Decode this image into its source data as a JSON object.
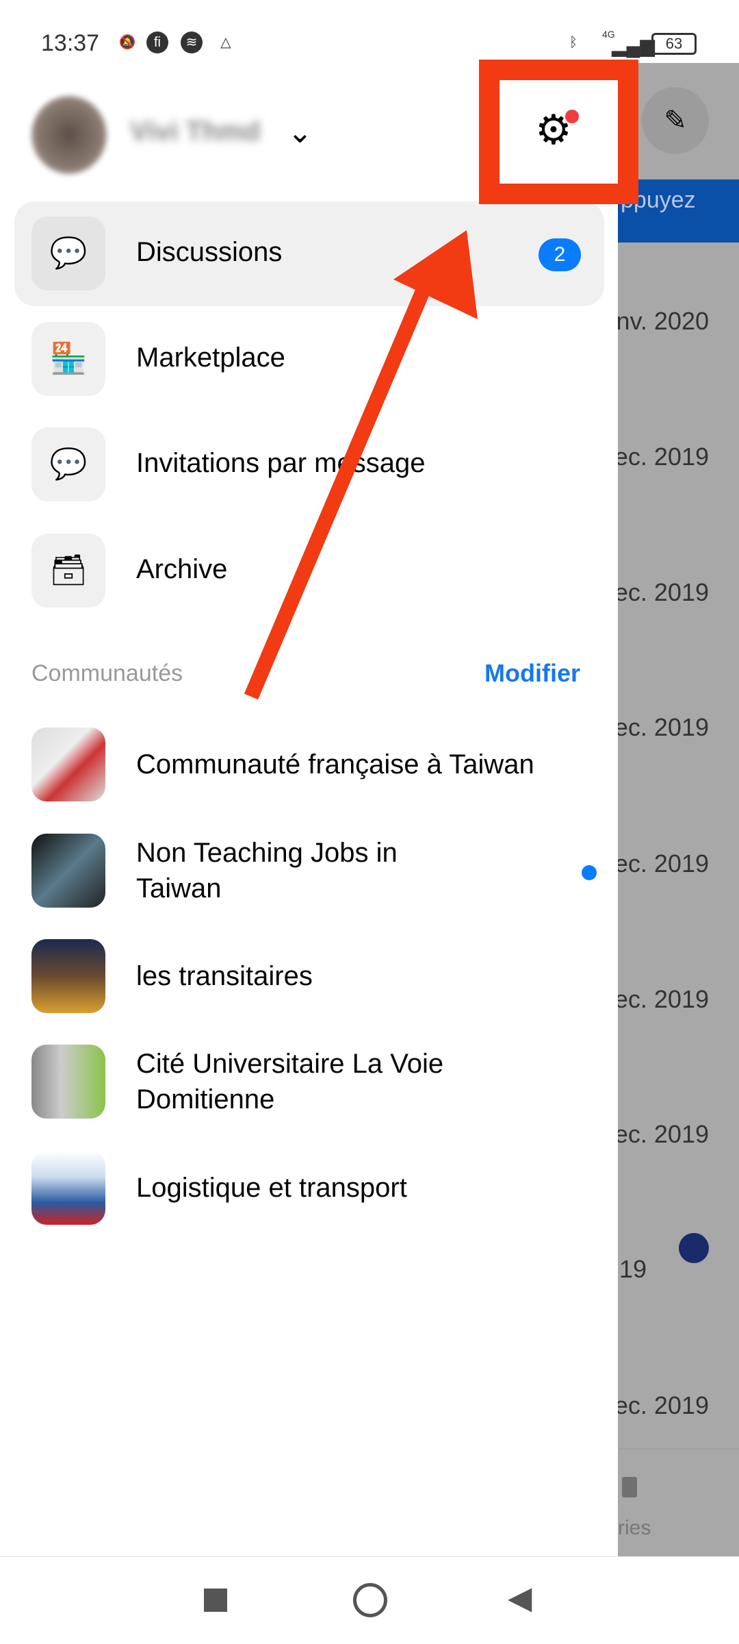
{
  "status_bar": {
    "time": "13:37",
    "battery": "63",
    "network": "4G"
  },
  "header": {
    "user_name": "Vivi Thmd"
  },
  "menu": [
    {
      "label": "Discussions",
      "icon": "chat-bubble-icon",
      "badge": "2",
      "selected": true
    },
    {
      "label": "Marketplace",
      "icon": "shop-icon"
    },
    {
      "label": "Invitations par message",
      "icon": "message-dots-icon"
    },
    {
      "label": "Archive",
      "icon": "archive-box-icon"
    }
  ],
  "communities": {
    "title": "Communautés",
    "edit_label": "Modifier",
    "items": [
      {
        "label": "Communauté française à Taiwan",
        "unread": false
      },
      {
        "label": "Non Teaching Jobs in Taiwan",
        "unread": true
      },
      {
        "label": "les transitaires",
        "unread": false
      },
      {
        "label": "Cité Universitaire La Voie Domitienne",
        "unread": false
      },
      {
        "label": "Logistique et transport",
        "unread": false
      }
    ]
  },
  "background": {
    "banner": "ppuyez",
    "dates": [
      "nv. 2020",
      "ec. 2019",
      "ec. 2019",
      "ec. 2019",
      "ec. 2019",
      "ec. 2019",
      "ec. 2019",
      "19",
      "ec. 2019"
    ],
    "tab_label": "ries"
  },
  "annotation": {
    "color": "#f23a13"
  }
}
